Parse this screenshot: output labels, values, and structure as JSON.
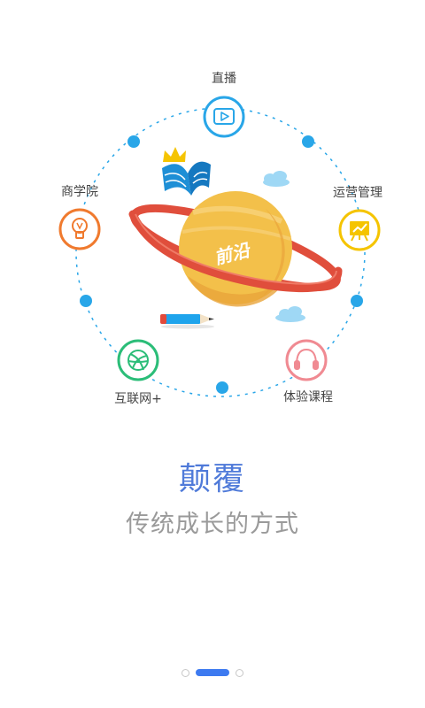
{
  "nodes": {
    "live": "直播",
    "business_school": "商学院",
    "operations": "运营管理",
    "internet_plus": "互联网+",
    "trial_course": "体验课程"
  },
  "planet_label": "前沿",
  "headline": "颠覆",
  "subline": "传统成长的方式",
  "pager": {
    "total": 3,
    "current": 2
  },
  "colors": {
    "accent_blue": "#29a6e8",
    "headline_blue": "#4f7ad9",
    "pager_active": "#3d7af0",
    "orange": "#f07a2e",
    "yellow": "#f5c400",
    "green": "#2bbd78",
    "pink": "#f08a92"
  },
  "icons": {
    "live": "play-icon",
    "business_school": "lightbulb-icon",
    "operations": "chart-board-icon",
    "internet_plus": "basketball-icon",
    "trial_course": "headphones-icon"
  }
}
